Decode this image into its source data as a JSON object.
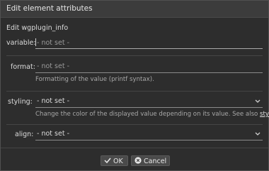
{
  "window": {
    "title": "Edit element attributes"
  },
  "heading": "Edit wgplugin_info",
  "fields": {
    "variable": {
      "label": "variable:",
      "placeholder": "- not set -"
    },
    "format": {
      "label": "format:",
      "placeholder": "- not set -",
      "help": "Formatting of the value (printf syntax)."
    },
    "styling": {
      "label": "styling:",
      "value": "- not set -",
      "help": "Change the color of the displayed value depending on its value. See also",
      "help_link": "styling"
    },
    "align": {
      "label": "align:",
      "value": "- not set -"
    }
  },
  "buttons": {
    "ok": "OK",
    "cancel": "Cancel"
  },
  "colors": {
    "background": "#2d2d2d",
    "titlebar": "#3c3c3c",
    "text": "#dcdcdc"
  },
  "icons": [
    "chevron-down-icon",
    "check-icon",
    "cancel-circle-icon"
  ]
}
